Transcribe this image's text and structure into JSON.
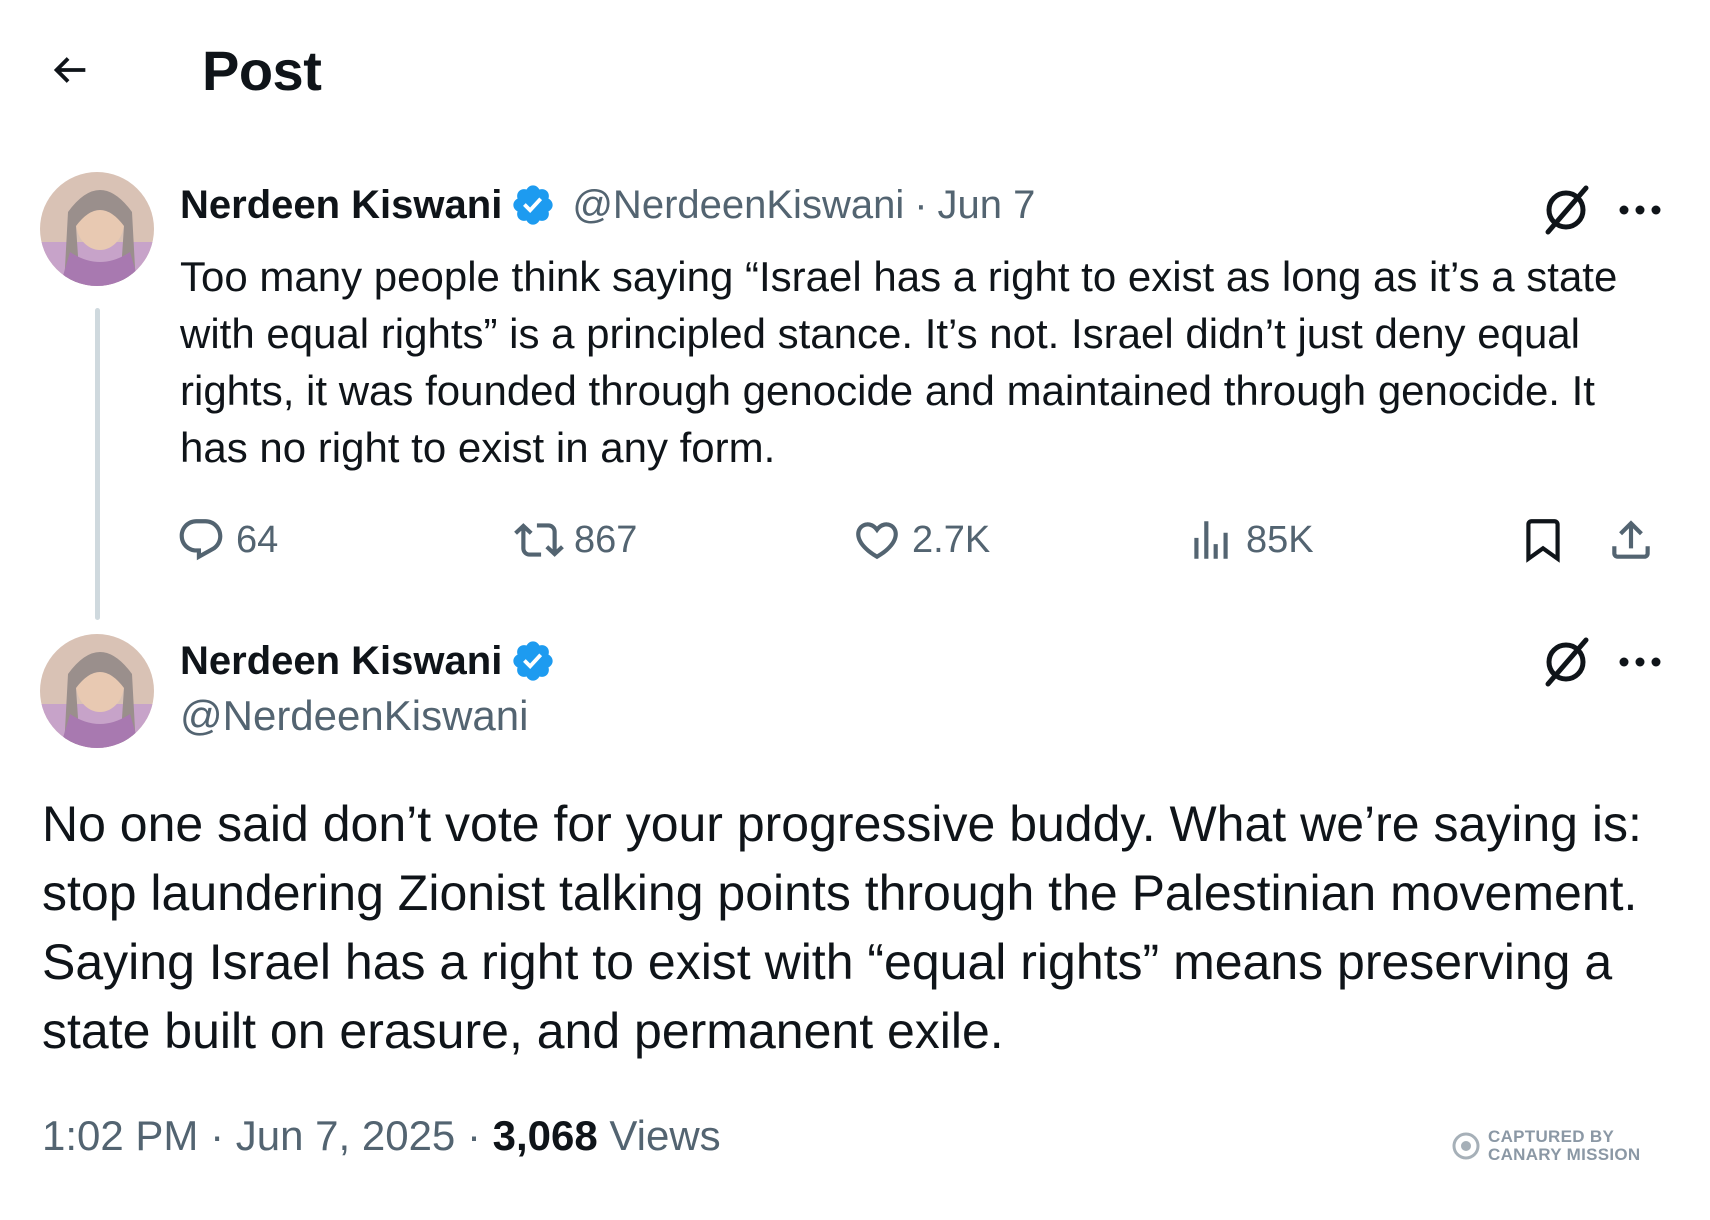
{
  "header": {
    "title": "Post",
    "back_icon": "arrow-left-icon"
  },
  "parent_post": {
    "author": "Nerdeen Kiswani",
    "handle": "@NerdeenKiswani",
    "separator": "·",
    "date": "Jun 7",
    "text": "Too many people think saying “Israel has a right to exist as long as it’s a state with equal rights” is a principled stance. It’s not. Israel didn’t just deny equal rights, it was founded through genocide and maintained through genocide. It has no right to exist in any form.",
    "stats": {
      "replies": "64",
      "reposts": "867",
      "likes": "2.7K",
      "views": "85K"
    }
  },
  "main_post": {
    "author": "Nerdeen Kiswani",
    "handle": "@NerdeenKiswani",
    "text": "No one said don’t vote for your progressive buddy. What we’re saying is: stop laundering Zionist talking points through the Palestinian movement. Saying Israel has a right to exist  with “equal rights”  means preserving a state built on erasure, and permanent exile.",
    "time": "1:02 PM",
    "sep1": "·",
    "date": "Jun 7, 2025",
    "sep2": "·",
    "views_count": "3,068",
    "views_label": "Views"
  },
  "watermark": {
    "line1": "CAPTURED BY",
    "line2": "CANARY MISSION"
  },
  "colors": {
    "text": "#0f1419",
    "secondary": "#536471",
    "verified": "#1d9bf0",
    "thread_line": "#cfd9de"
  }
}
